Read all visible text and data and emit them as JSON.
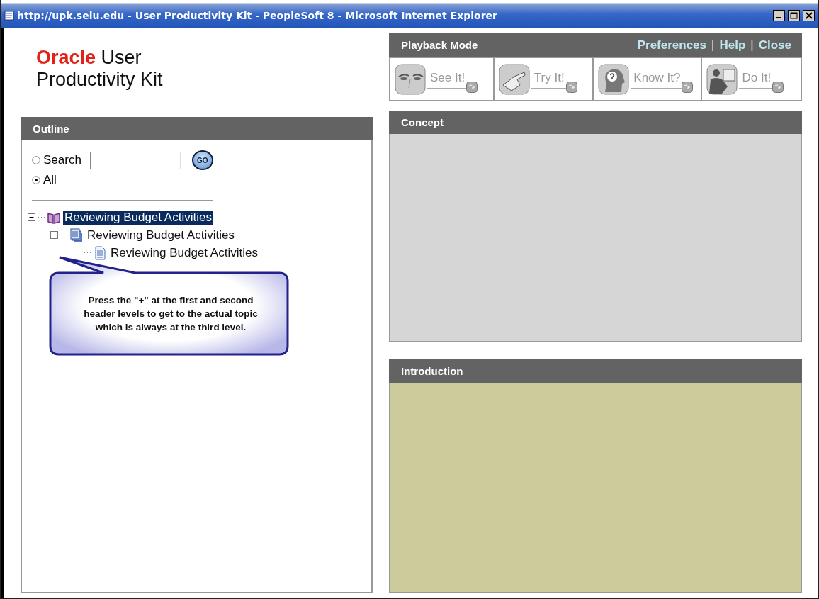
{
  "window": {
    "title": "http://upk.selu.edu - User Productivity Kit - PeopleSoft 8 - Microsoft Internet Explorer"
  },
  "logo": {
    "brand": "Oracle",
    "product_line1": "User",
    "product_line2": "Productivity Kit"
  },
  "playback": {
    "title": "Playback Mode",
    "links": [
      "Preferences",
      "Help",
      "Close"
    ],
    "link_separator": "|",
    "modes": [
      {
        "kind": "see",
        "label": "See It!",
        "disabled": true
      },
      {
        "kind": "try",
        "label": "Try It!",
        "disabled": true
      },
      {
        "kind": "know",
        "label": "Know It?",
        "disabled": true
      },
      {
        "kind": "do",
        "label": "Do It!",
        "disabled": true
      }
    ]
  },
  "outline": {
    "title": "Outline",
    "search_options": [
      {
        "label": "Search",
        "selected": false
      },
      {
        "label": "All",
        "selected": true
      }
    ],
    "go_button": "GO",
    "tree": [
      {
        "kind": "book",
        "label": "Reviewing Budget Activities",
        "expanded": true,
        "selected": true,
        "children": [
          {
            "kind": "pages",
            "label": "Reviewing Budget Activities",
            "expanded": true,
            "selected": false,
            "children": [
              {
                "kind": "doc",
                "label": "Reviewing Budget Activities",
                "selected": false
              }
            ]
          }
        ]
      }
    ],
    "callout": "Press the \"+\" at the first and second header levels to get to the actual topic which is always at the third level."
  },
  "concept": {
    "title": "Concept"
  },
  "introduction": {
    "title": "Introduction"
  }
}
